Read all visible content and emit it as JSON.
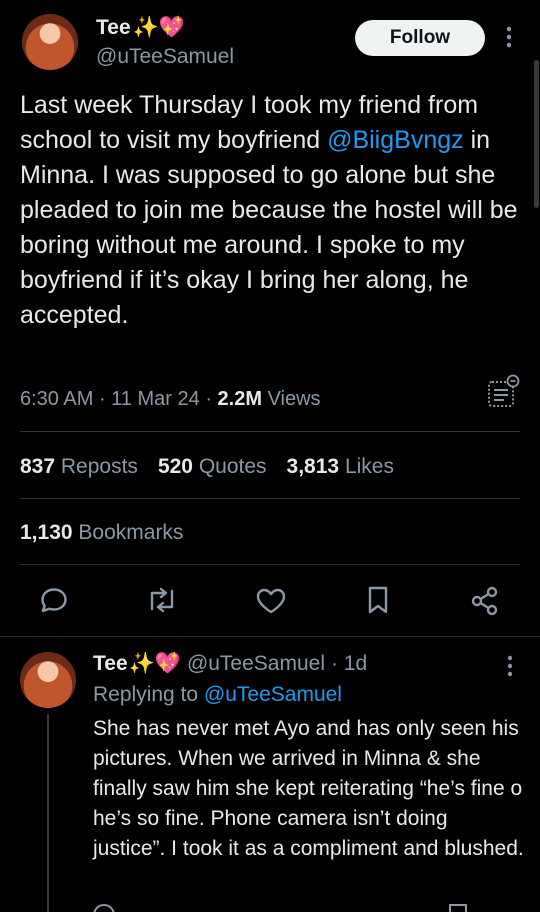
{
  "tweet": {
    "author_name": "Tee",
    "author_emoji": "✨💖",
    "handle": "@uTeeSamuel",
    "follow_label": "Follow",
    "text_before_mention": "Last week Thursday I took my friend from school to visit my boyfriend",
    "mention": "@BiigBvngz",
    "text_after_mention": "in Minna. I was supposed to go alone but she pleaded to join me because the hostel will be boring without me around. I spoke to my boyfriend if it’s okay I bring her along, he accepted.",
    "time": "6:30 AM",
    "date": "11 Mar 24",
    "views_count": "2.2M",
    "views_label": "Views",
    "reposts_count": "837",
    "reposts_label": "Reposts",
    "quotes_count": "520",
    "quotes_label": "Quotes",
    "likes_count": "3,813",
    "likes_label": "Likes",
    "bookmarks_count": "1,130",
    "bookmarks_label": "Bookmarks",
    "actions": [
      "reply-icon",
      "repost-icon",
      "like-icon",
      "bookmark-icon",
      "share-icon"
    ]
  },
  "reply": {
    "author_name": "Tee",
    "author_emoji": "✨💖",
    "handle": "@uTeeSamuel",
    "age": "· 1d",
    "replying_to_label": "Replying to",
    "replying_to_handle": "@uTeeSamuel",
    "text": "She has never met Ayo and has only seen his pictures. When we arrived in Minna & she finally saw him she kept reiterating “he’s fine o he’s so fine. Phone camera isn’t doing justice”. I took it as a compliment and blushed."
  },
  "colors": {
    "background": "#000000",
    "text": "#e7e9ea",
    "secondary": "#8b98a5",
    "accent": "#1d9bf0",
    "divider": "#2f3336"
  }
}
